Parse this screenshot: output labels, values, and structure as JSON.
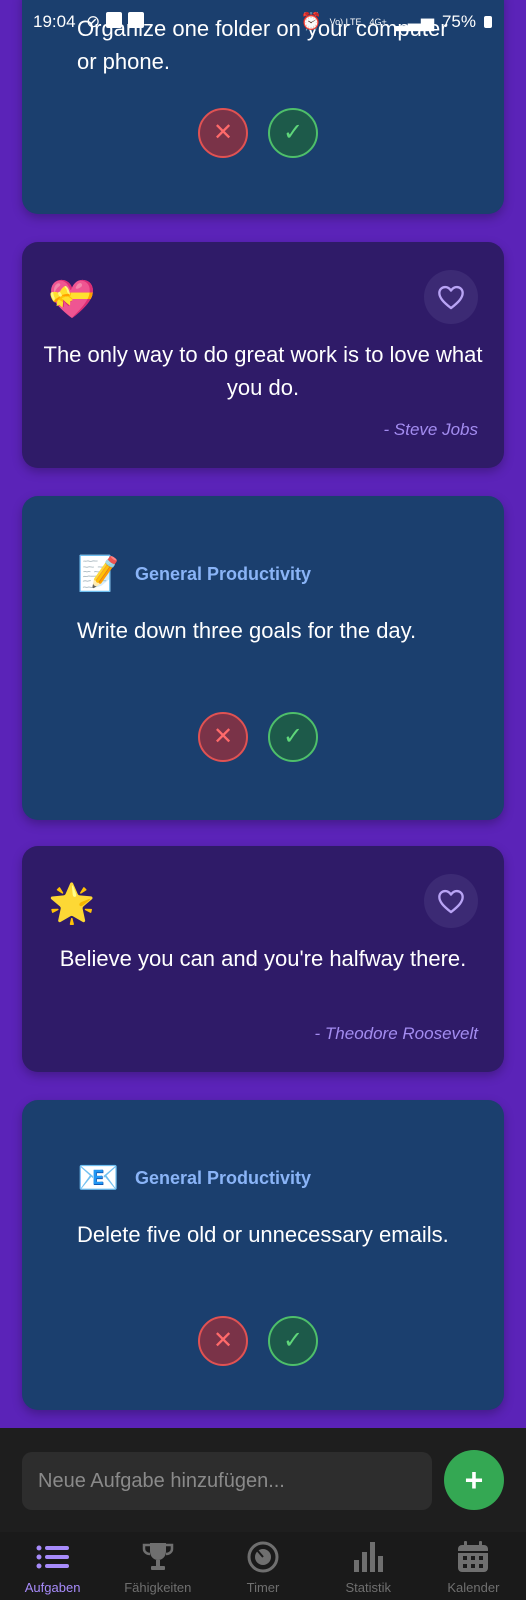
{
  "status_bar": {
    "time": "19:04",
    "battery": "75%",
    "net1": "Vo) LTE",
    "net2": "4G+"
  },
  "task_top": {
    "text": "Organize one folder on your computer or phone."
  },
  "quote_1": {
    "emoji": "💝",
    "text": "The only way to do great work is to love what you do.",
    "author": "- Steve Jobs"
  },
  "task_2": {
    "emoji": "📝",
    "category": "General Productivity",
    "text": "Write down three goals for the day."
  },
  "quote_2": {
    "emoji": "🌟",
    "text": "Believe you can and you're halfway there.",
    "author": "- Theodore Roosevelt"
  },
  "task_3": {
    "emoji": "📧",
    "category": "General Productivity",
    "text": "Delete five old or unnecessary emails."
  },
  "buttons": {
    "reject": "✕",
    "accept": "✓"
  },
  "new_task": {
    "placeholder": "Neue Aufgabe hinzufügen...",
    "add_label": "+"
  },
  "nav": {
    "tasks": "Aufgaben",
    "skills": "Fähigkeiten",
    "timer": "Timer",
    "stats": "Statistik",
    "calendar": "Kalender"
  },
  "colors": {
    "accent": "#a78bfa",
    "task_card": "#1b3f6e",
    "quote_card": "#2f1b68",
    "add_button": "#34a853",
    "background": "#5b23b8"
  }
}
